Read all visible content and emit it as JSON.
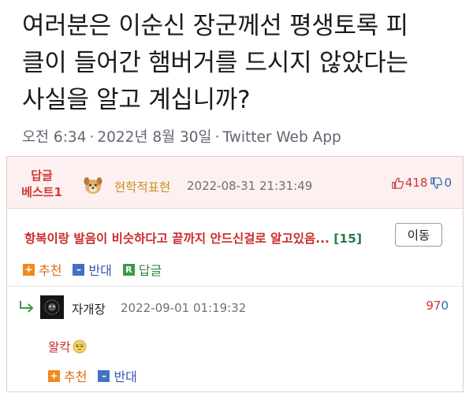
{
  "tweet": {
    "text_line1": "여러분은 이순신 장군께선 평생토록 피",
    "text_line2": "클이 들어간 햄버거를 드시지 않았다는",
    "text_line3": "사실을 알고 계십니까?",
    "time": "오전 6:34",
    "date": "2022년 8월 30일",
    "source": "Twitter Web App"
  },
  "best_comment": {
    "badge_line1": "답글",
    "badge_line2": "베스트1",
    "nickname": "현학적표현",
    "datetime": "2022-08-31 21:31:49",
    "up_count": "418",
    "down_count": "0",
    "body": "항복이랑 발음이 비슷하다고 끝까지 안드신걸로 알고있음...",
    "reply_count": "[15]",
    "move_button": "이동",
    "actions": {
      "recommend": "추천",
      "oppose": "반대",
      "reply": "답글",
      "reply_icon": "R"
    }
  },
  "reply_comment": {
    "nickname": "자개장",
    "datetime": "2022-09-01 01:19:32",
    "score": "97",
    "zero": "0",
    "body": "왈칵",
    "actions": {
      "recommend": "추천",
      "oppose": "반대"
    }
  },
  "colors": {
    "best_bg": "#fdf0f0",
    "red": "#cc2b2b",
    "gold": "#c6901e",
    "plus": "#f08a1e",
    "minus": "#4470c4",
    "reply": "#3a9a4a"
  },
  "icons": [
    "thumbs-up-icon",
    "thumbs-down-icon",
    "dog-avatar-icon",
    "reply-arrow-icon",
    "plus-icon",
    "minus-icon",
    "reply-icon",
    "teary-face-emoji-icon"
  ]
}
